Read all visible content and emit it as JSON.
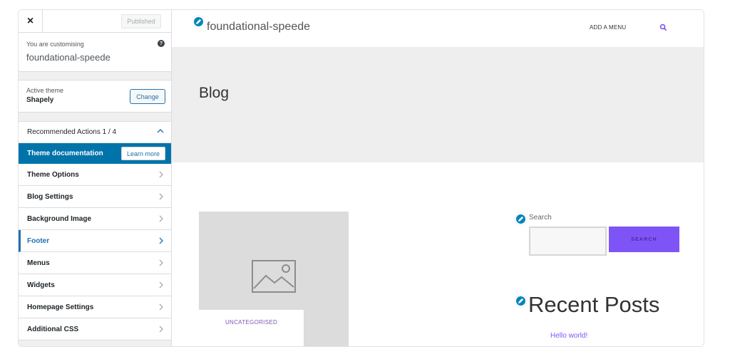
{
  "sidebar": {
    "close_label": "×",
    "publish_label": "Published",
    "customising_label": "You are customising",
    "site_name": "foundational-speede",
    "active_theme_label": "Active theme",
    "theme_name": "Shapely",
    "change_label": "Change",
    "recommended_label": "Recommended Actions 1 / 4",
    "doc_label": "Theme documentation",
    "learn_more_label": "Learn more",
    "items": [
      {
        "label": "Theme Options"
      },
      {
        "label": "Blog Settings"
      },
      {
        "label": "Background Image"
      },
      {
        "label": "Footer",
        "active": true
      },
      {
        "label": "Menus"
      },
      {
        "label": "Widgets"
      },
      {
        "label": "Homepage Settings"
      },
      {
        "label": "Additional CSS"
      }
    ]
  },
  "preview": {
    "site_title": "foundational-speede",
    "nav_menu": "ADD A MENU",
    "hero_title": "Blog",
    "post_category": "UNCATEGORISED",
    "search_label": "Search",
    "search_button": "SEARCH",
    "recent_posts_title": "Recent Posts",
    "recent_post_link": "Hello world!"
  },
  "colors": {
    "accent": "#0073aa",
    "button_purple": "#7f54f7",
    "link_purple": "#7f54b3"
  },
  "icons": [
    "close-icon",
    "help-icon",
    "chevron-up-icon",
    "chevron-right-icon",
    "edit-pencil-icon",
    "search-icon",
    "image-placeholder-icon"
  ]
}
